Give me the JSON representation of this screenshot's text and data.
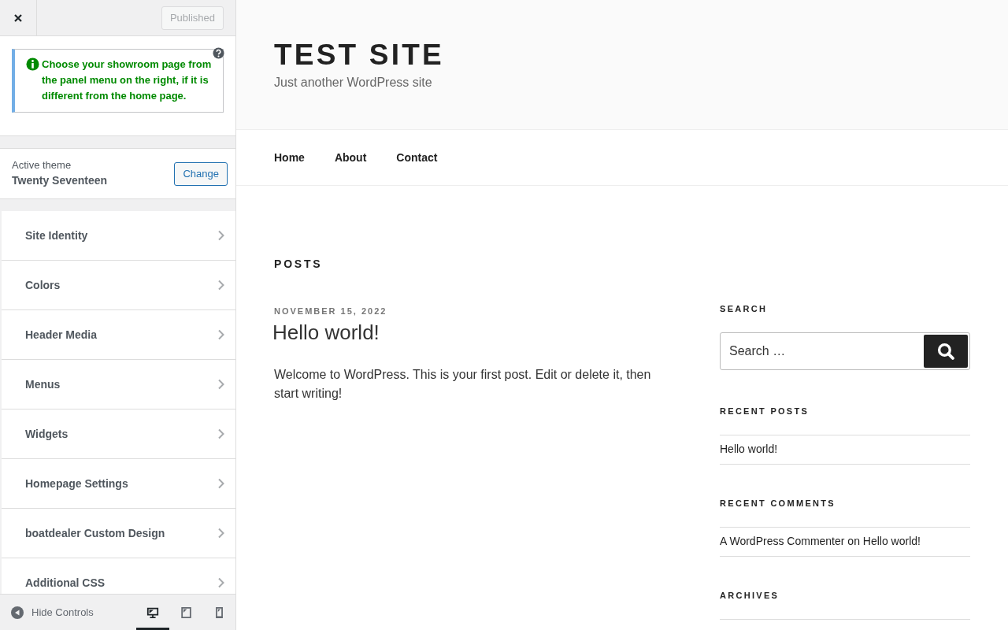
{
  "customizer": {
    "publish_button": {
      "label": "Published",
      "disabled": true
    },
    "notice": {
      "text": "Choose your showroom page from the panel menu on the right, if it is different from the home page."
    },
    "theme": {
      "caption": "Active theme",
      "name": "Twenty Seventeen",
      "change_button": "Change"
    },
    "sections": [
      {
        "label": "Site Identity"
      },
      {
        "label": "Colors"
      },
      {
        "label": "Header Media"
      },
      {
        "label": "Menus"
      },
      {
        "label": "Widgets"
      },
      {
        "label": "Homepage Settings"
      },
      {
        "label": "boatdealer Custom Design"
      },
      {
        "label": "Additional CSS"
      }
    ],
    "footer": {
      "hide_controls": "Hide Controls",
      "devices": [
        {
          "kind": "desktop",
          "selected": true
        },
        {
          "kind": "tablet",
          "selected": false
        },
        {
          "kind": "mobile",
          "selected": false
        }
      ]
    }
  },
  "site": {
    "title": "TEST SITE",
    "tagline": "Just another WordPress site",
    "nav": [
      {
        "label": "Home"
      },
      {
        "label": "About"
      },
      {
        "label": "Contact"
      }
    ],
    "page_title": "POSTS",
    "post": {
      "date": "NOVEMBER 15, 2022",
      "title": "Hello world!",
      "excerpt": "Welcome to WordPress. This is your first post. Edit or delete it, then start writing!"
    },
    "widgets": {
      "search": {
        "heading": "SEARCH",
        "placeholder": "Search …"
      },
      "recent_posts": {
        "heading": "RECENT POSTS",
        "items": [
          "Hello world!"
        ]
      },
      "recent_comments": {
        "heading": "RECENT COMMENTS",
        "items": [
          {
            "author": "A WordPress Commenter",
            "joiner": "on",
            "post": "Hello world!"
          }
        ]
      },
      "archives": {
        "heading": "ARCHIVES"
      }
    }
  }
}
